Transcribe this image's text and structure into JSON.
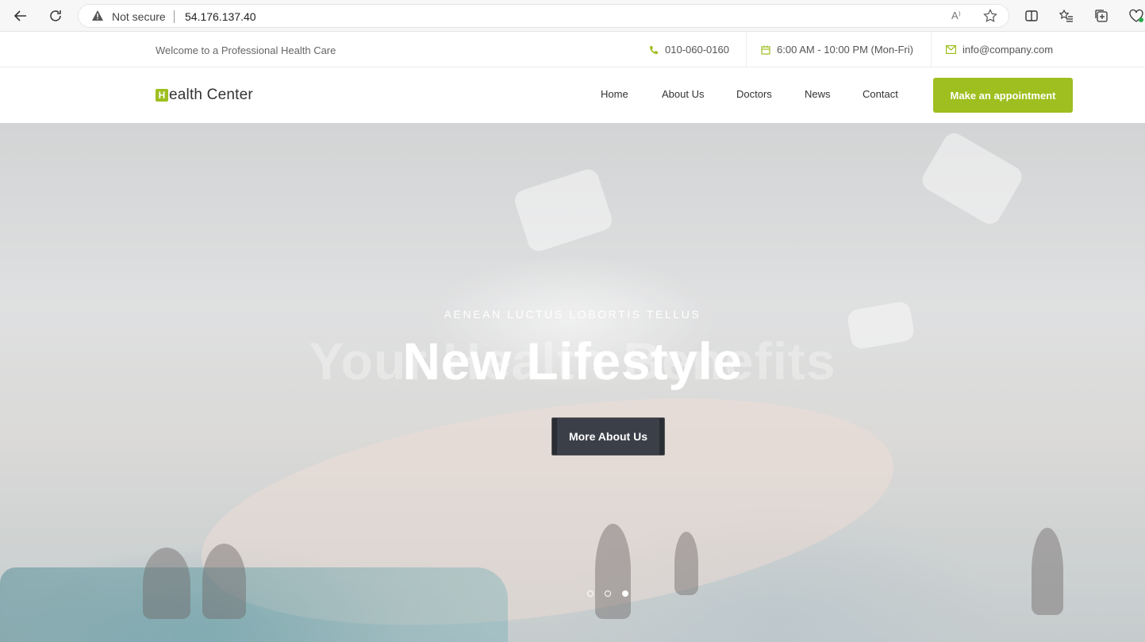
{
  "browser": {
    "security_label": "Not secure",
    "url": "54.176.137.40",
    "read_aloud": "A⁾"
  },
  "topbar": {
    "welcome": "Welcome to a Professional Health Care",
    "phone": "010-060-0160",
    "hours": "6:00 AM - 10:00 PM (Mon-Fri)",
    "email": "info@company.com"
  },
  "header": {
    "logo_letter": "H",
    "logo_text": "ealth Center",
    "menu": [
      "Home",
      "About Us",
      "Doctors",
      "News",
      "Contact"
    ],
    "cta_label": "Make an appointment",
    "accent_color": "#9ebf1f"
  },
  "hero": {
    "subtitle": "AENEAN LUCTUS LOBORTIS TELLUS",
    "ghost_title": "Your Health Benefits",
    "title": "New Lifestyle",
    "button_label": "More About Us",
    "slides_total": 3,
    "active_slide": 3
  }
}
